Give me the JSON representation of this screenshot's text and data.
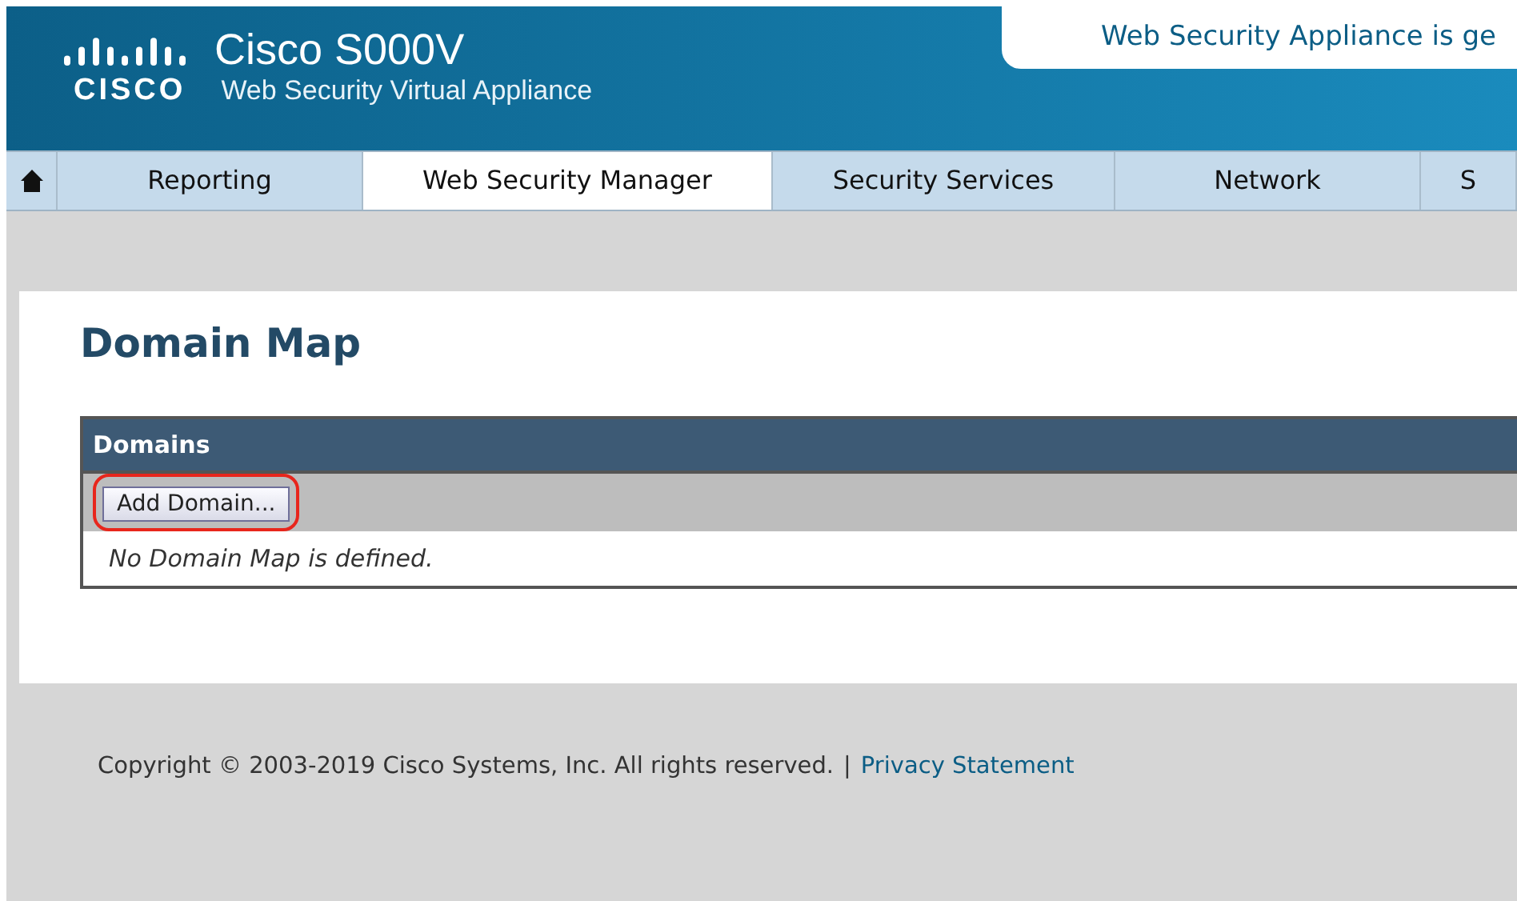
{
  "header": {
    "logo_word": "CISCO",
    "product": "Cisco S000V",
    "subtitle": "Web Security Virtual Appliance",
    "notice": "Web Security Appliance is ge"
  },
  "nav": [
    {
      "label": "Reporting",
      "selected": false
    },
    {
      "label": "Web Security Manager",
      "selected": true
    },
    {
      "label": "Security Services",
      "selected": false
    },
    {
      "label": "Network",
      "selected": false
    },
    {
      "label": "S",
      "selected": false
    }
  ],
  "page": {
    "title": "Domain Map",
    "table": {
      "heading": "Domains",
      "button": {
        "label": "Add Domain...",
        "highlighted": true
      },
      "empty_message": "No Domain Map is defined."
    }
  },
  "footer": {
    "copyright": "Copyright © 2003-2019 Cisco Systems, Inc. All rights reserved.",
    "separator": "|",
    "link": "Privacy Statement"
  }
}
